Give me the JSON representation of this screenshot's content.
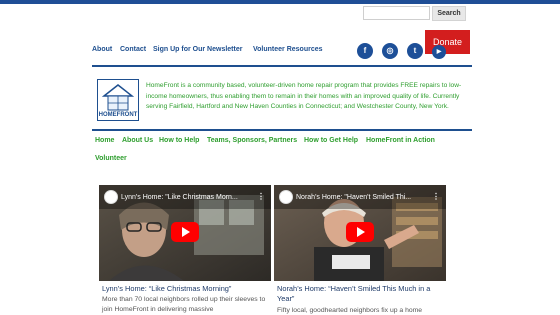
{
  "search": {
    "placeholder": "",
    "button_label": "Search"
  },
  "topnav": [
    "About",
    "Contact",
    "Sign Up for Our Newsletter",
    "Volunteer Resources"
  ],
  "social": [
    {
      "name": "facebook",
      "glyph": "f"
    },
    {
      "name": "instagram",
      "glyph": "◎"
    },
    {
      "name": "twitter",
      "glyph": "t"
    },
    {
      "name": "youtube",
      "glyph": "▶"
    }
  ],
  "donate_label": "Donate",
  "logo_text": "HOMEFRONT",
  "description": "HomeFront is a community based, volunteer-driven home repair program that provides FREE repairs to low-income homeowners, thus enabling them to remain in their homes with an improved quality of life. Currently serving Fairfield, Hartford and New Haven Counties in Connecticut; and Westchester County, New York.",
  "mainnav": [
    "Home",
    "About Us",
    "How to Help",
    "Teams, Sponsors, Partners",
    "How to Get Help",
    "HomeFront in Action",
    "Volunteer"
  ],
  "cards": [
    {
      "video_title": "Lynn's Home: \"Like Christmas Morn...",
      "title": "Lynn’s Home: “Like Christmas Morning”",
      "text": "More than 70 local neighbors rolled up their sleeves to join HomeFront in delivering massive"
    },
    {
      "video_title": "Norah's Home: \"Haven't Smiled Thi...",
      "title": "Norah’s Home: “Haven’t Smiled This Much in a Year”",
      "text": "Fifty local, goodhearted neighbors fix up a home"
    }
  ],
  "colors": {
    "brand_blue": "#1e4f8f",
    "accent_green": "#2e9e2e",
    "donate_red": "#d31e1e"
  }
}
